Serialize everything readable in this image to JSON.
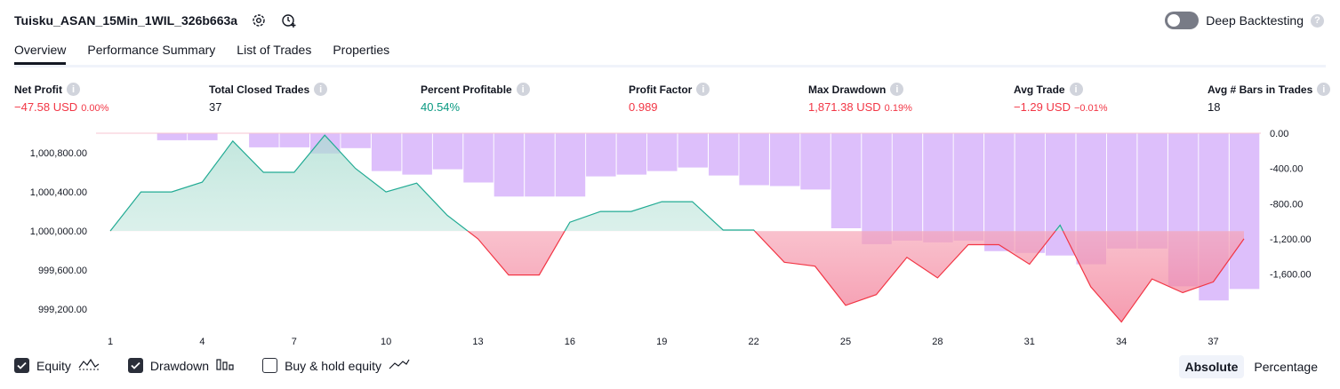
{
  "header": {
    "title": "Tuisku_ASAN_15Min_1WIL_326b663a",
    "settings_icon": "gear-icon",
    "alert_icon": "add-alert-icon",
    "deep_backtesting_label": "Deep Backtesting",
    "deep_backtesting_on": false
  },
  "tabs": [
    {
      "label": "Overview",
      "active": true
    },
    {
      "label": "Performance Summary",
      "active": false
    },
    {
      "label": "List of Trades",
      "active": false
    },
    {
      "label": "Properties",
      "active": false
    }
  ],
  "metrics": {
    "net_profit": {
      "label": "Net Profit",
      "value": "−47.58 USD",
      "pct": "0.00%"
    },
    "total_closed_trades": {
      "label": "Total Closed Trades",
      "value": "37"
    },
    "percent_profitable": {
      "label": "Percent Profitable",
      "value": "40.54%"
    },
    "profit_factor": {
      "label": "Profit Factor",
      "value": "0.989"
    },
    "max_drawdown": {
      "label": "Max Drawdown",
      "value": "1,871.38 USD",
      "pct": "0.19%"
    },
    "avg_trade": {
      "label": "Avg Trade",
      "value": "−1.29 USD",
      "pct": "−0.01%"
    },
    "avg_bars": {
      "label": "Avg # Bars in Trades",
      "value": "18"
    }
  },
  "chart_data": {
    "type": "line",
    "x": [
      1,
      2,
      3,
      4,
      5,
      6,
      7,
      8,
      9,
      10,
      11,
      12,
      13,
      14,
      15,
      16,
      17,
      18,
      19,
      20,
      21,
      22,
      23,
      24,
      25,
      26,
      27,
      28,
      29,
      30,
      31,
      32,
      33,
      34,
      35,
      36,
      37,
      38
    ],
    "x_ticks": [
      "1",
      "4",
      "7",
      "10",
      "13",
      "16",
      "19",
      "22",
      "25",
      "28",
      "31",
      "34",
      "37"
    ],
    "equity": [
      1000000,
      1000400,
      1000400,
      1000500,
      1000920,
      1000600,
      1000600,
      1000980,
      1000640,
      1000400,
      1000490,
      1000160,
      999920,
      999550,
      999550,
      1000090,
      1000200,
      1000200,
      1000300,
      1000300,
      1000010,
      1000010,
      999680,
      999640,
      999240,
      999350,
      999730,
      999520,
      999860,
      999860,
      999660,
      1000060,
      999430,
      999070,
      999510,
      999370,
      999480,
      999920
    ],
    "drawdown": [
      0,
      0,
      -80,
      -80,
      0,
      -80,
      -80,
      -230,
      -90,
      -150,
      -430,
      -210,
      -310,
      -530,
      -720,
      -720,
      -720,
      -490,
      -470,
      -430,
      -390,
      -480,
      -590,
      -450,
      -600,
      -640,
      -680,
      -950,
      -1080,
      -1300,
      -1260,
      -1220,
      -1240,
      -1220,
      -1340,
      -1240,
      -1340,
      -1320,
      -1350,
      -1450,
      -1710,
      -1660,
      -1620,
      -1600,
      -1620,
      -1850,
      -1900,
      -1660,
      -1400
    ],
    "drawdown_bars": [
      0,
      0,
      -80,
      -80,
      0,
      -160,
      -160,
      -230,
      -170,
      -430,
      -470,
      -410,
      -560,
      -720,
      -720,
      -720,
      -490,
      -470,
      -430,
      -390,
      -480,
      -590,
      -600,
      -640,
      -1080,
      -1260,
      -1220,
      -1240,
      -1220,
      -1340,
      -1360,
      -1390,
      -1490,
      -1310,
      -1310,
      -1740,
      -1900,
      -1770,
      -1890,
      -1720,
      -1480
    ],
    "drawdown_series": [
      0,
      0,
      -80,
      -80,
      0,
      -160,
      -160,
      -230,
      -170,
      -430,
      -470,
      -410,
      -560,
      -720,
      -720,
      -720,
      -490,
      -470,
      -430,
      -390,
      -480,
      -590,
      -600,
      -640,
      -1080,
      -1260,
      -1220,
      -1240,
      -1220,
      -1340,
      -1360,
      -1390,
      -1490,
      -1310,
      -1310,
      -1740,
      -1900,
      -1770,
      -1890,
      -1720,
      -1480
    ],
    "left_axis": {
      "ticks": [
        "1,000,800.00",
        "1,000,400.00",
        "1,000,000.00",
        "999,600.00",
        "999,200.00"
      ],
      "values": [
        1000800,
        1000400,
        1000000,
        999600,
        999200
      ],
      "range": [
        999020,
        1001000
      ]
    },
    "right_axis": {
      "ticks": [
        "0.00",
        "-400.00",
        "-800.00",
        "-1,200.00",
        "-1,600.00"
      ],
      "values": [
        0,
        -400,
        -800,
        -1200,
        -1600
      ],
      "range": [
        -2200,
        0
      ]
    },
    "colors": {
      "equity_line": "#22ab94",
      "equity_fill": "#d4efe9",
      "equity_neg_line": "#f23645",
      "equity_neg_fill": "#f7a9b7",
      "drawdown_bar": "#ddbffb"
    }
  },
  "legend": [
    {
      "label": "Equity",
      "checked": true,
      "icon": "equity-line-icon"
    },
    {
      "label": "Drawdown",
      "checked": true,
      "icon": "drawdown-bars-icon"
    },
    {
      "label": "Buy & hold equity",
      "checked": false,
      "icon": "buy-hold-line-icon"
    }
  ],
  "mode": {
    "absolute": "Absolute",
    "percentage": "Percentage"
  }
}
